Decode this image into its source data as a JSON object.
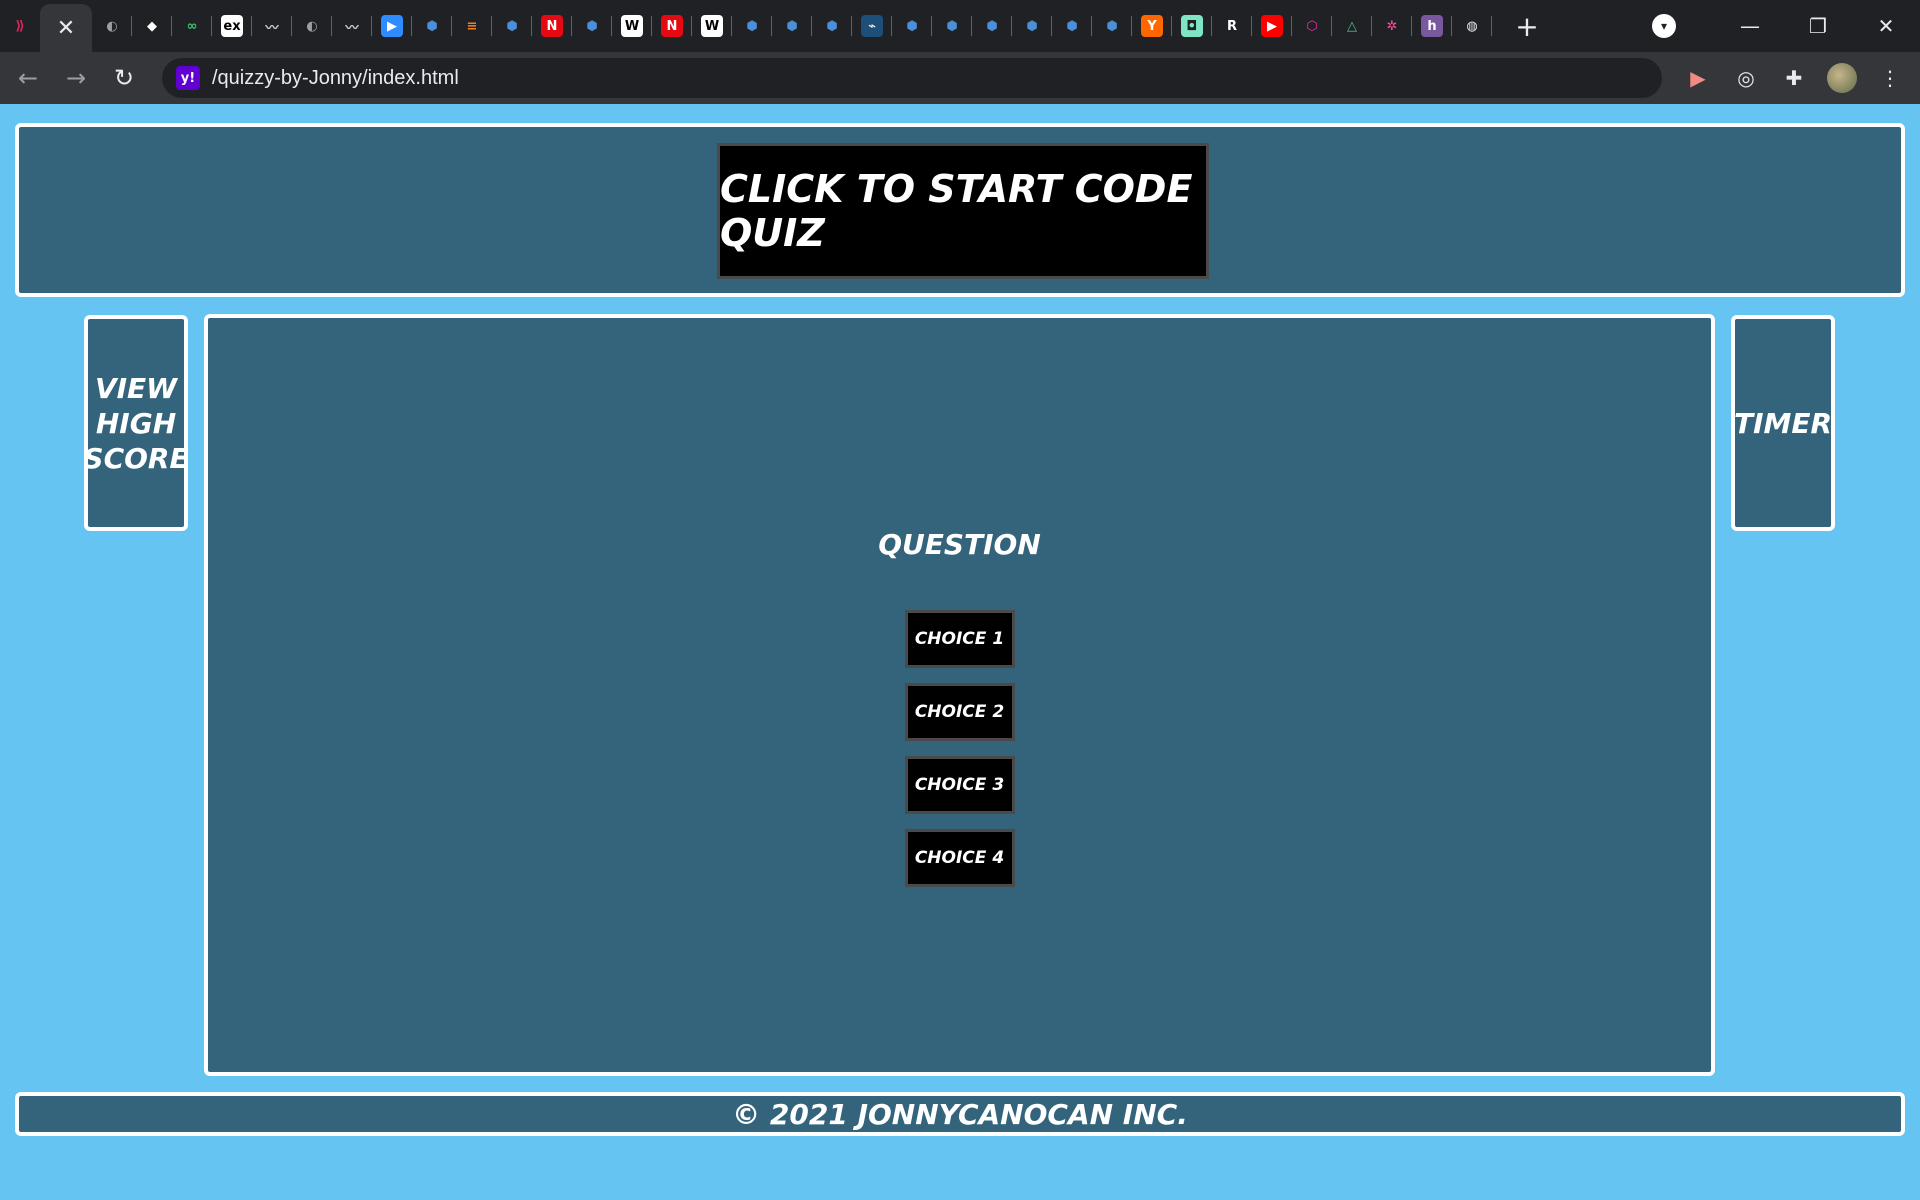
{
  "browser": {
    "tabs": [
      {
        "icon": "arrow-logo-icon",
        "glyph": "⟫",
        "bg": "#202124",
        "fg": "#e0245e"
      },
      {
        "icon": "close-icon",
        "glyph": "✕",
        "bg": "#35363a",
        "fg": "#e8eaed",
        "active": true
      },
      {
        "icon": "github-icon",
        "glyph": "◐",
        "bg": "#202124",
        "fg": "#9aa0a6"
      },
      {
        "icon": "bird-icon",
        "glyph": "◆",
        "bg": "#202124",
        "fg": "#ffffff"
      },
      {
        "icon": "gitkraken-icon",
        "glyph": "∞",
        "bg": "#202124",
        "fg": "#3ec46d"
      },
      {
        "icon": "expressjs-icon",
        "glyph": "ex",
        "bg": "#ffffff",
        "fg": "#000000"
      },
      {
        "icon": "mustache-icon",
        "glyph": "〰",
        "bg": "#202124",
        "fg": "#cccccc"
      },
      {
        "icon": "github-icon",
        "glyph": "◐",
        "bg": "#202124",
        "fg": "#9aa0a6"
      },
      {
        "icon": "mustache-icon",
        "glyph": "〰",
        "bg": "#202124",
        "fg": "#cccccc"
      },
      {
        "icon": "zoom-icon",
        "glyph": "▶",
        "bg": "#2d8cff",
        "fg": "#ffffff"
      },
      {
        "icon": "cube-icon",
        "glyph": "⬢",
        "bg": "#202124",
        "fg": "#4a90d9"
      },
      {
        "icon": "stackoverflow-icon",
        "glyph": "≡",
        "bg": "#202124",
        "fg": "#f48024"
      },
      {
        "icon": "cube-icon",
        "glyph": "⬢",
        "bg": "#202124",
        "fg": "#4a90d9"
      },
      {
        "icon": "netflix-icon",
        "glyph": "N",
        "bg": "#e50914",
        "fg": "#ffffff"
      },
      {
        "icon": "cube-icon",
        "glyph": "⬢",
        "bg": "#202124",
        "fg": "#4a90d9"
      },
      {
        "icon": "wikipedia-icon",
        "glyph": "W",
        "bg": "#ffffff",
        "fg": "#000000"
      },
      {
        "icon": "netflix-icon",
        "glyph": "N",
        "bg": "#e50914",
        "fg": "#ffffff"
      },
      {
        "icon": "wikipedia-icon",
        "glyph": "W",
        "bg": "#ffffff",
        "fg": "#000000"
      },
      {
        "icon": "cube-icon",
        "glyph": "⬢",
        "bg": "#202124",
        "fg": "#4a90d9"
      },
      {
        "icon": "cube-icon",
        "glyph": "⬢",
        "bg": "#202124",
        "fg": "#4a90d9"
      },
      {
        "icon": "cube-icon",
        "glyph": "⬢",
        "bg": "#202124",
        "fg": "#4a90d9"
      },
      {
        "icon": "mysql-icon",
        "glyph": "⌁",
        "bg": "#1d4f7a",
        "fg": "#ffffff"
      },
      {
        "icon": "cube-icon",
        "glyph": "⬢",
        "bg": "#202124",
        "fg": "#4a90d9"
      },
      {
        "icon": "cube-icon",
        "glyph": "⬢",
        "bg": "#202124",
        "fg": "#4a90d9"
      },
      {
        "icon": "cube-icon",
        "glyph": "⬢",
        "bg": "#202124",
        "fg": "#4a90d9"
      },
      {
        "icon": "cube-icon",
        "glyph": "⬢",
        "bg": "#202124",
        "fg": "#4a90d9"
      },
      {
        "icon": "cube-icon",
        "glyph": "⬢",
        "bg": "#202124",
        "fg": "#4a90d9"
      },
      {
        "icon": "cube-icon",
        "glyph": "⬢",
        "bg": "#202124",
        "fg": "#4a90d9"
      },
      {
        "icon": "ycombinator-icon",
        "glyph": "Y",
        "bg": "#ff6600",
        "fg": "#ffffff"
      },
      {
        "icon": "robot-icon",
        "glyph": "◘",
        "bg": "#7ee6c4",
        "fg": "#202124"
      },
      {
        "icon": "r-icon",
        "glyph": "R",
        "bg": "#202124",
        "fg": "#ffffff"
      },
      {
        "icon": "youtube-icon",
        "glyph": "▶",
        "bg": "#ff0000",
        "fg": "#ffffff"
      },
      {
        "icon": "graphql-icon",
        "glyph": "⬡",
        "bg": "#202124",
        "fg": "#e535ab"
      },
      {
        "icon": "triangle-icon",
        "glyph": "△",
        "bg": "#202124",
        "fg": "#4fc08d"
      },
      {
        "icon": "sparkle-icon",
        "glyph": "✲",
        "bg": "#202124",
        "fg": "#ff4fa3"
      },
      {
        "icon": "heroku-icon",
        "glyph": "h",
        "bg": "#79589f",
        "fg": "#ffffff"
      },
      {
        "icon": "globe-icon",
        "glyph": "◍",
        "bg": "#202124",
        "fg": "#e8eaed"
      }
    ],
    "url": "/quizzy-by-Jonny/index.html",
    "site_glyph": "y!"
  },
  "quiz": {
    "start_button": "Click to start code quiz",
    "high_score": "View High Score",
    "timer": "Timer",
    "question": "Question",
    "choices": [
      "Choice 1",
      "Choice 2",
      "Choice 3",
      "Choice 4"
    ],
    "footer": "© 2021 jonnycanocan Inc."
  },
  "colors": {
    "page_bg": "#66c4f2",
    "panel_bg": "#33647c",
    "panel_border": "#ffffff",
    "button_bg": "#000000"
  }
}
